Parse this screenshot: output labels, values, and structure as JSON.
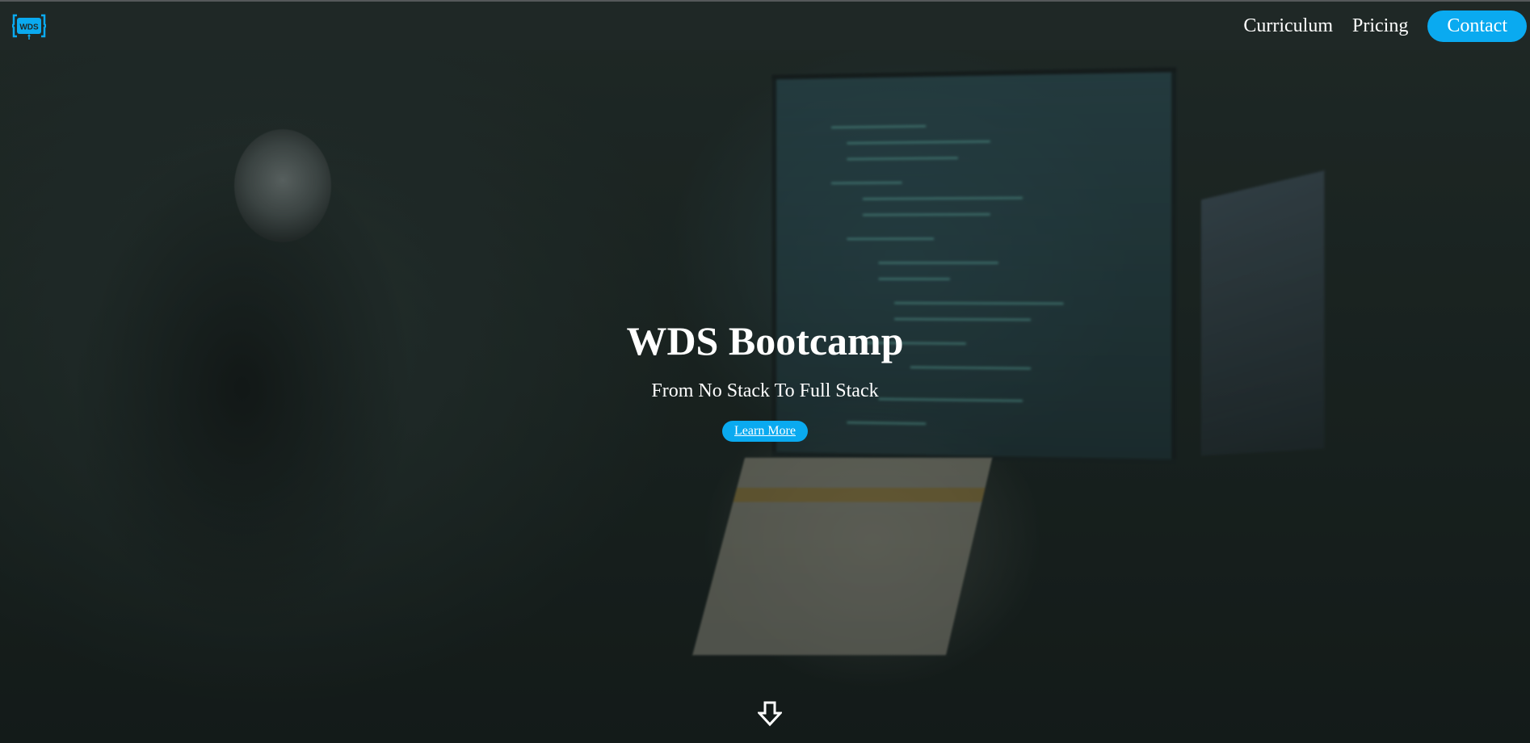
{
  "navbar": {
    "logo_text": "WDS",
    "links": [
      {
        "label": "Curriculum"
      },
      {
        "label": "Pricing"
      },
      {
        "label": "Contact"
      }
    ]
  },
  "hero": {
    "title": "WDS Bootcamp",
    "subtitle": "From No Stack To Full Stack",
    "cta_label": "Learn More"
  },
  "icons": {
    "logo": "wds-logo-icon",
    "scroll": "arrow-down-icon"
  },
  "colors": {
    "accent": "#0aaaf0",
    "navbar_bg": "#1f2826",
    "text": "#ffffff"
  }
}
